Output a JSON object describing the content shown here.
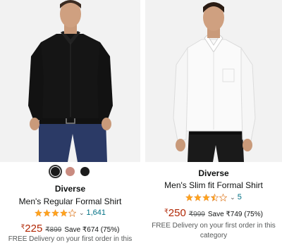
{
  "products": [
    {
      "image_alt": "Man wearing black formal shirt and navy trousers",
      "swatches": [
        {
          "color": "#1a1a1a",
          "selected": true
        },
        {
          "color": "#c98b80",
          "selected": false
        },
        {
          "color": "#1c1c1c",
          "selected": false
        }
      ],
      "brand": "Diverse",
      "title": "Men's Regular Formal Shirt",
      "rating": 4.0,
      "rating_count": "1,641",
      "currency": "₹",
      "price": "225",
      "mrp": "₹899",
      "save": "Save ₹674 (75%)",
      "delivery": "FREE Delivery on your first order in this"
    },
    {
      "image_alt": "Man wearing white slim fit formal shirt and black trousers",
      "brand": "Diverse",
      "title": "Men's Slim fit Formal Shirt",
      "rating": 3.5,
      "rating_count": "5",
      "currency": "₹",
      "price": "250",
      "mrp": "₹999",
      "save": "Save ₹749 (75%)",
      "delivery": "FREE Delivery on your first order in this category"
    }
  ],
  "colors": {
    "price": "#b12704",
    "link": "#007185",
    "star": "#ffa41c"
  }
}
